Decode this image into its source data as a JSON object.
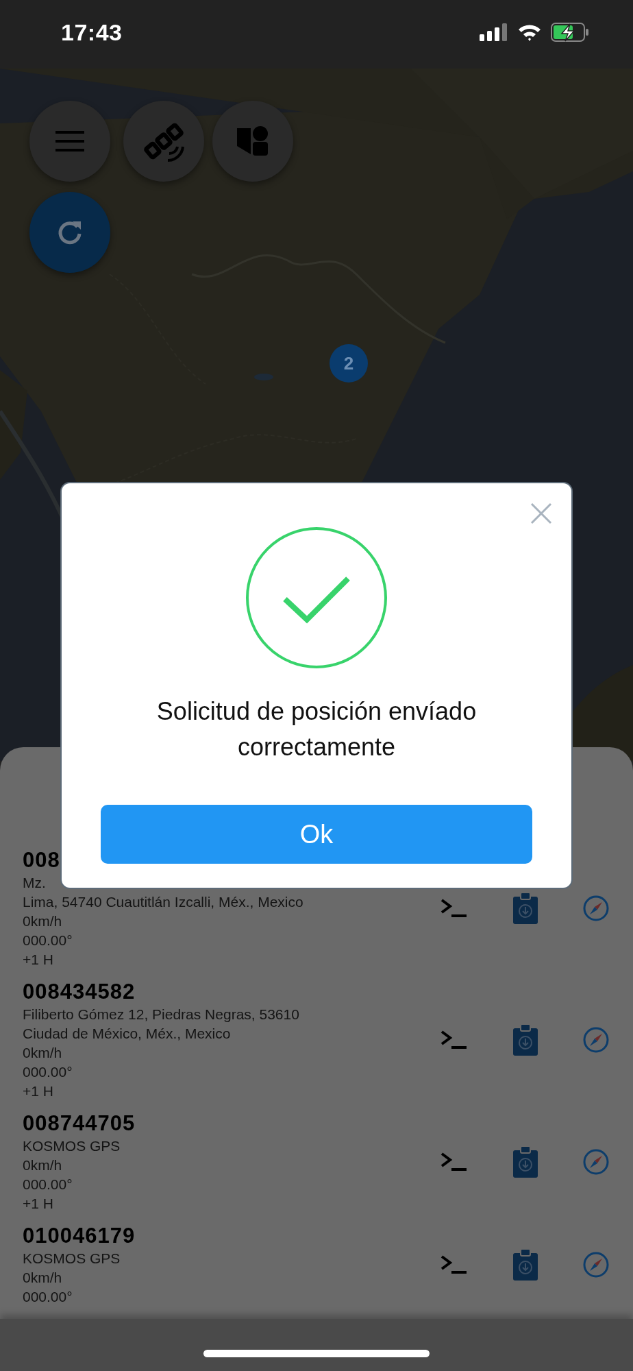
{
  "status_bar": {
    "time": "17:43"
  },
  "map": {
    "kind": "picture",
    "cluster_marker": {
      "count": "2"
    }
  },
  "map_buttons": [
    {
      "kind": "menu"
    },
    {
      "kind": "satellite"
    },
    {
      "kind": "layers"
    },
    {
      "kind": "refresh"
    }
  ],
  "devices": [
    {
      "id": "008",
      "details": [
        "Mz.",
        "Lima, 54740 Cuautitlán Izcalli, Méx., Mexico",
        "0km/h",
        "000.00°",
        "+1 H"
      ]
    },
    {
      "id": "008434582",
      "details": [
        "Filiberto Gómez 12, Piedras Negras, 53610",
        "Ciudad de México, Méx., Mexico",
        "0km/h",
        "000.00°",
        "+1 H"
      ]
    },
    {
      "id": "008744705",
      "details": [
        "KOSMOS GPS",
        "0km/h",
        "000.00°",
        "+1 H"
      ]
    },
    {
      "id": "010046179",
      "details": [
        "KOSMOS GPS",
        "0km/h",
        "000.00°"
      ]
    }
  ],
  "dialog": {
    "message": "Solicitud de posición envíado correctamente",
    "button": "Ok"
  }
}
